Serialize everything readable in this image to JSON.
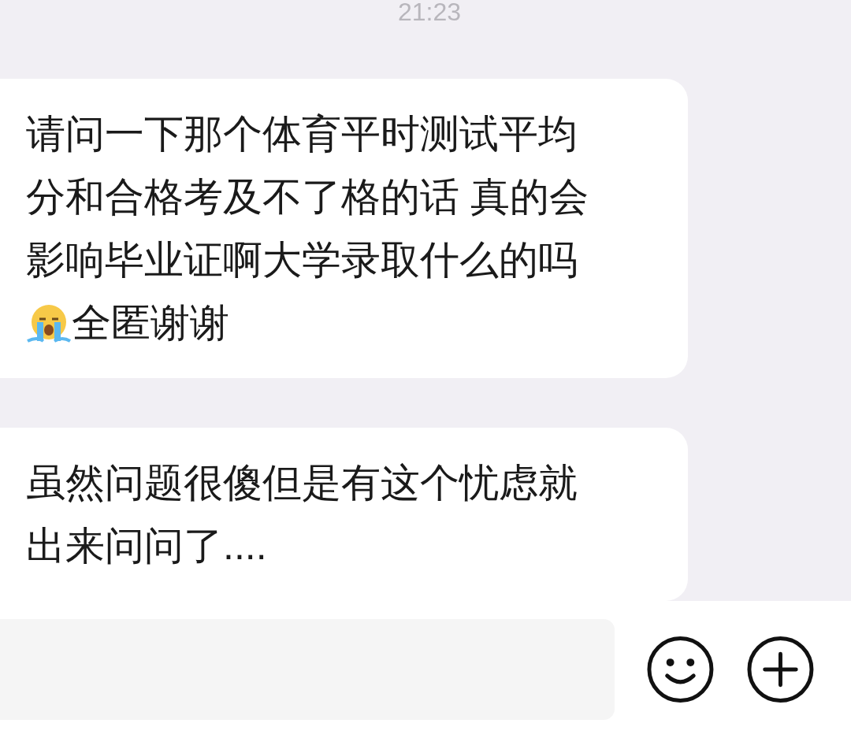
{
  "timestamp": "21:23",
  "messages": [
    {
      "text": "请问一下那个体育平时测试平均分和合格考及不了格的话 真的会影响毕业证啊大学录取什么的吗",
      "tail": "全匿谢谢"
    },
    {
      "text": "虽然问题很傻但是有这个忧虑就出来问问了...."
    }
  ]
}
